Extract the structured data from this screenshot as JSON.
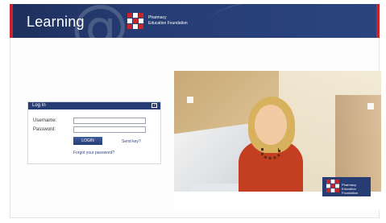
{
  "header": {
    "title": "Learning",
    "foundation_line1": "Pharmacy",
    "foundation_line2": "Education Foundation"
  },
  "login": {
    "panel_title": "Log In",
    "help_icon": "?",
    "username_label": "Username:",
    "password_label": "Password:",
    "login_button": "LOGIN",
    "send_key_link": "Send key?",
    "forgot_password_link": "Forgot your password?"
  },
  "photo_badge": {
    "line1": "Pharmacy",
    "line2": "Education Foundation"
  },
  "colors": {
    "navy": "#263c73",
    "red": "#c9242b"
  }
}
